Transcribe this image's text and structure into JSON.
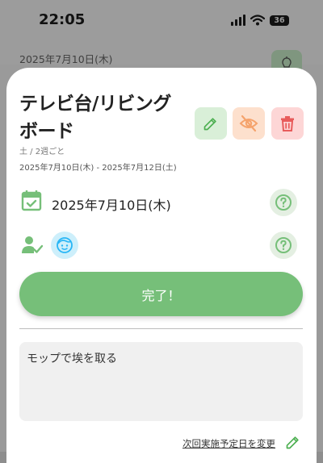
{
  "status_bar": {
    "time": "22:05",
    "battery": "36"
  },
  "background": {
    "date": "2025年7月10日(木)"
  },
  "task": {
    "title": "テレビ台/リビングボード",
    "subtitle": "土 / 2週ごと",
    "date_range": "2025年7月10日(木) - 2025年7月12日(土)",
    "scheduled_date": "2025年7月10日(木)",
    "memo": "モップで埃を取る"
  },
  "actions": {
    "complete_label": "完了！",
    "change_next_label": "次回実施予定日を変更"
  },
  "colors": {
    "accent_green": "#76bf79",
    "edit": "#4caf50",
    "hide": "#f5a36c",
    "delete": "#e85b5b",
    "avatar": "#29b6f6"
  },
  "icons": {
    "edit": "pencil-icon",
    "hide": "eye-off-icon",
    "delete": "trash-icon",
    "calendar": "calendar-check-icon",
    "assignee": "person-check-icon",
    "help": "help-circle-icon",
    "avatar": "face-icon"
  }
}
